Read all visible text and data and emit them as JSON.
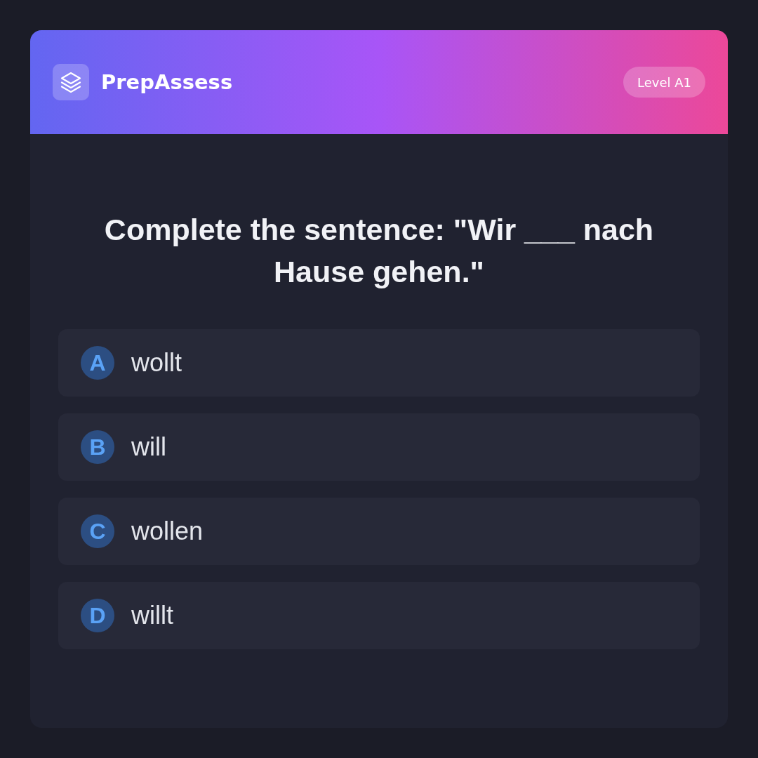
{
  "header": {
    "app_name": "PrepAssess",
    "level_badge": "Level A1"
  },
  "question": {
    "text": "Complete the sentence: \"Wir ___ nach Hause gehen.\""
  },
  "options": [
    {
      "letter": "A",
      "text": "wollt",
      "selected": false
    },
    {
      "letter": "B",
      "text": "will",
      "selected": false
    },
    {
      "letter": "C",
      "text": "wollen",
      "selected": false
    },
    {
      "letter": "D",
      "text": "willt",
      "selected": false
    }
  ]
}
